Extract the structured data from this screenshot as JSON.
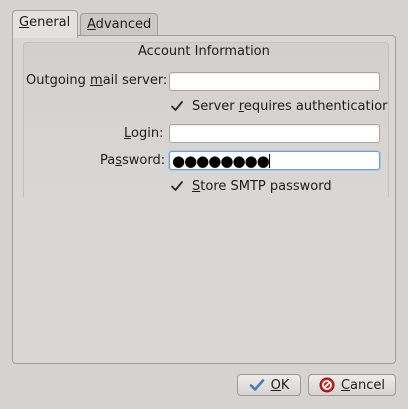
{
  "tabs": {
    "general": "General",
    "advanced": "Advanced"
  },
  "account_info": {
    "title": "Account Information",
    "outgoing_server": {
      "label_pre": "Outgoing ",
      "label_u": "m",
      "label_post": "ail server:",
      "value": ""
    },
    "requires_auth": {
      "label_pre": "Server ",
      "label_u": "r",
      "label_post": "equires authenticatior",
      "checked": true
    },
    "login": {
      "label_u": "L",
      "label_post": "ogin:",
      "value": ""
    },
    "password": {
      "label_pre": "Pa",
      "label_u": "s",
      "label_post": "sword:",
      "masked": "●●●●●●●●"
    },
    "store_password": {
      "label_u": "S",
      "label_post": "tore SMTP password",
      "checked": true
    }
  },
  "buttons": {
    "ok_u": "O",
    "ok_post": "K",
    "cancel_u": "C",
    "cancel_post": "ancel"
  },
  "colors": {
    "ok_check": "#4a7ab5",
    "cancel_red": "#c8241c"
  }
}
